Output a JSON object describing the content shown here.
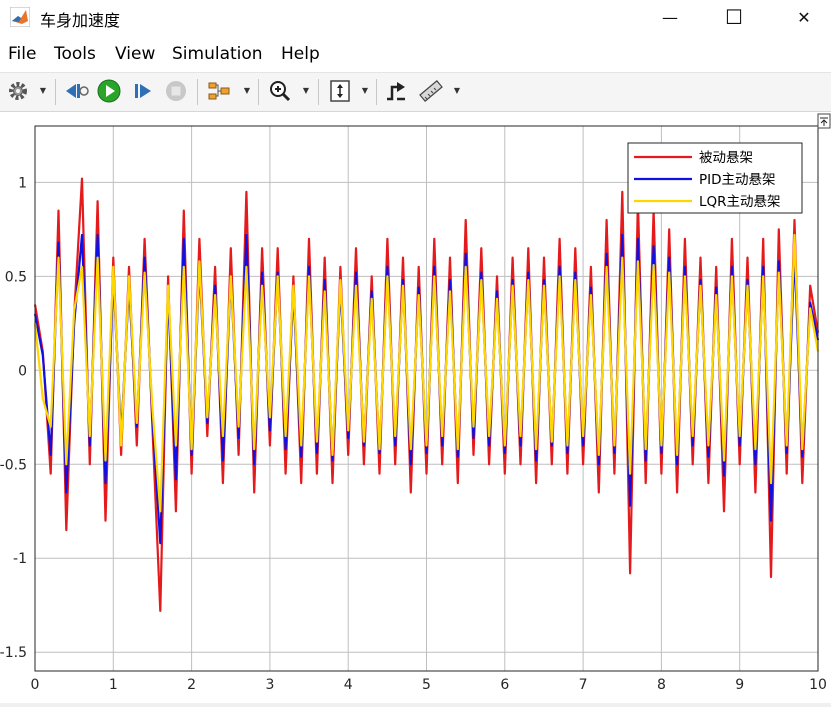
{
  "window": {
    "title": "车身加速度",
    "controls": {
      "minimize": "—",
      "maximize": "☐",
      "close": "✕"
    }
  },
  "menu": [
    "File",
    "Tools",
    "View",
    "Simulation",
    "Help"
  ],
  "toolbar": {
    "icons": [
      "settings-icon",
      "step-back-icon",
      "run-icon",
      "step-forward-icon",
      "stop-icon",
      "signal-select-icon",
      "zoom-icon",
      "fit-to-view-icon",
      "trigger-icon",
      "measure-icon"
    ]
  },
  "colors": {
    "passive": "#e41a1c",
    "pid": "#1010e0",
    "lqr": "#ffd700",
    "run": "#2aa52a",
    "grid": "#bfbfbf"
  },
  "chart_data": {
    "type": "line",
    "title": "",
    "xlabel": "",
    "ylabel": "",
    "xlim": [
      0,
      10
    ],
    "ylim": [
      -1.6,
      1.3
    ],
    "xticks": [
      "0",
      "1",
      "2",
      "3",
      "4",
      "5",
      "6",
      "7",
      "8",
      "9",
      "10"
    ],
    "yticks": [
      "-1.5",
      "-1",
      "-0.5",
      "0",
      "0.5",
      "1"
    ],
    "grid": true,
    "legend_position": "top-right",
    "note_sampling": "signals approximated at 0.1 s resolution from the plotted traces",
    "x": [
      0,
      0.1,
      0.2,
      0.3,
      0.4,
      0.5,
      0.6,
      0.7,
      0.8,
      0.9,
      1.0,
      1.1,
      1.2,
      1.3,
      1.4,
      1.5,
      1.6,
      1.7,
      1.8,
      1.9,
      2.0,
      2.1,
      2.2,
      2.3,
      2.4,
      2.5,
      2.6,
      2.7,
      2.8,
      2.9,
      3.0,
      3.1,
      3.2,
      3.3,
      3.4,
      3.5,
      3.6,
      3.7,
      3.8,
      3.9,
      4.0,
      4.1,
      4.2,
      4.3,
      4.4,
      4.5,
      4.6,
      4.7,
      4.8,
      4.9,
      5.0,
      5.1,
      5.2,
      5.3,
      5.4,
      5.5,
      5.6,
      5.7,
      5.8,
      5.9,
      6.0,
      6.1,
      6.2,
      6.3,
      6.4,
      6.5,
      6.6,
      6.7,
      6.8,
      6.9,
      7.0,
      7.1,
      7.2,
      7.3,
      7.4,
      7.5,
      7.6,
      7.7,
      7.8,
      7.9,
      8.0,
      8.1,
      8.2,
      8.3,
      8.4,
      8.5,
      8.6,
      8.7,
      8.8,
      8.9,
      9.0,
      9.1,
      9.2,
      9.3,
      9.4,
      9.5,
      9.6,
      9.7,
      9.8,
      9.9,
      10.0
    ],
    "series": [
      {
        "name": "被动悬架",
        "color": "#e41a1c",
        "values": [
          0.35,
          0.1,
          -0.55,
          0.85,
          -0.85,
          0.3,
          1.02,
          -0.5,
          0.9,
          -0.8,
          0.6,
          -0.45,
          0.55,
          -0.4,
          0.7,
          -0.3,
          -1.28,
          0.5,
          -0.75,
          0.85,
          -0.55,
          0.7,
          -0.35,
          0.55,
          -0.6,
          0.65,
          -0.45,
          0.95,
          -0.65,
          0.65,
          -0.4,
          0.65,
          -0.55,
          0.5,
          -0.6,
          0.7,
          -0.55,
          0.6,
          -0.6,
          0.55,
          -0.45,
          0.65,
          -0.5,
          0.5,
          -0.55,
          0.7,
          -0.5,
          0.6,
          -0.65,
          0.55,
          -0.55,
          0.7,
          -0.5,
          0.6,
          -0.6,
          0.8,
          -0.45,
          0.65,
          -0.5,
          0.5,
          -0.55,
          0.6,
          -0.5,
          0.65,
          -0.6,
          0.6,
          -0.5,
          0.7,
          -0.55,
          0.65,
          -0.5,
          0.55,
          -0.65,
          0.8,
          -0.55,
          0.95,
          -1.08,
          0.9,
          -0.6,
          0.85,
          -0.55,
          0.75,
          -0.65,
          0.7,
          -0.5,
          0.6,
          -0.6,
          0.55,
          -0.75,
          0.7,
          -0.5,
          0.6,
          -0.65,
          0.7,
          -1.1,
          0.75,
          -0.55,
          0.8,
          -0.6,
          0.45,
          0.2
        ]
      },
      {
        "name": "PID主动悬架",
        "color": "#1010e0",
        "values": [
          0.3,
          0.08,
          -0.45,
          0.68,
          -0.65,
          0.25,
          0.72,
          -0.4,
          0.72,
          -0.6,
          0.5,
          -0.35,
          0.45,
          -0.3,
          0.6,
          -0.25,
          -0.92,
          0.42,
          -0.58,
          0.7,
          -0.45,
          0.55,
          -0.28,
          0.45,
          -0.48,
          0.5,
          -0.36,
          0.72,
          -0.5,
          0.52,
          -0.32,
          0.52,
          -0.42,
          0.42,
          -0.46,
          0.55,
          -0.44,
          0.48,
          -0.48,
          0.45,
          -0.36,
          0.52,
          -0.4,
          0.42,
          -0.44,
          0.55,
          -0.4,
          0.48,
          -0.5,
          0.44,
          -0.44,
          0.55,
          -0.4,
          0.48,
          -0.46,
          0.62,
          -0.36,
          0.52,
          -0.4,
          0.42,
          -0.44,
          0.48,
          -0.4,
          0.52,
          -0.48,
          0.48,
          -0.4,
          0.55,
          -0.44,
          0.52,
          -0.4,
          0.44,
          -0.5,
          0.62,
          -0.44,
          0.72,
          -0.72,
          0.7,
          -0.48,
          0.66,
          -0.44,
          0.6,
          -0.5,
          0.55,
          -0.4,
          0.48,
          -0.46,
          0.44,
          -0.56,
          0.55,
          -0.4,
          0.48,
          -0.5,
          0.55,
          -0.8,
          0.58,
          -0.44,
          0.62,
          -0.46,
          0.36,
          0.16
        ]
      },
      {
        "name": "LQR主动悬架",
        "color": "#ffd700",
        "values": [
          0.25,
          -0.15,
          -0.3,
          0.6,
          -0.5,
          0.32,
          0.55,
          -0.35,
          0.6,
          -0.48,
          0.55,
          -0.4,
          0.5,
          -0.28,
          0.52,
          -0.2,
          -0.75,
          0.45,
          -0.4,
          0.55,
          -0.42,
          0.58,
          -0.25,
          0.4,
          -0.35,
          0.5,
          -0.3,
          0.55,
          -0.42,
          0.45,
          -0.25,
          0.5,
          -0.35,
          0.45,
          -0.4,
          0.5,
          -0.38,
          0.42,
          -0.45,
          0.48,
          -0.32,
          0.45,
          -0.38,
          0.38,
          -0.42,
          0.5,
          -0.35,
          0.45,
          -0.42,
          0.4,
          -0.4,
          0.5,
          -0.35,
          0.42,
          -0.42,
          0.55,
          -0.3,
          0.48,
          -0.35,
          0.38,
          -0.4,
          0.45,
          -0.35,
          0.48,
          -0.42,
          0.45,
          -0.38,
          0.5,
          -0.4,
          0.48,
          -0.35,
          0.4,
          -0.45,
          0.55,
          -0.4,
          0.6,
          -0.55,
          0.58,
          -0.42,
          0.56,
          -0.4,
          0.52,
          -0.45,
          0.5,
          -0.35,
          0.45,
          -0.4,
          0.4,
          -0.48,
          0.5,
          -0.35,
          0.45,
          -0.42,
          0.5,
          -0.6,
          0.52,
          -0.4,
          0.72,
          -0.42,
          0.33,
          0.1
        ]
      }
    ]
  }
}
